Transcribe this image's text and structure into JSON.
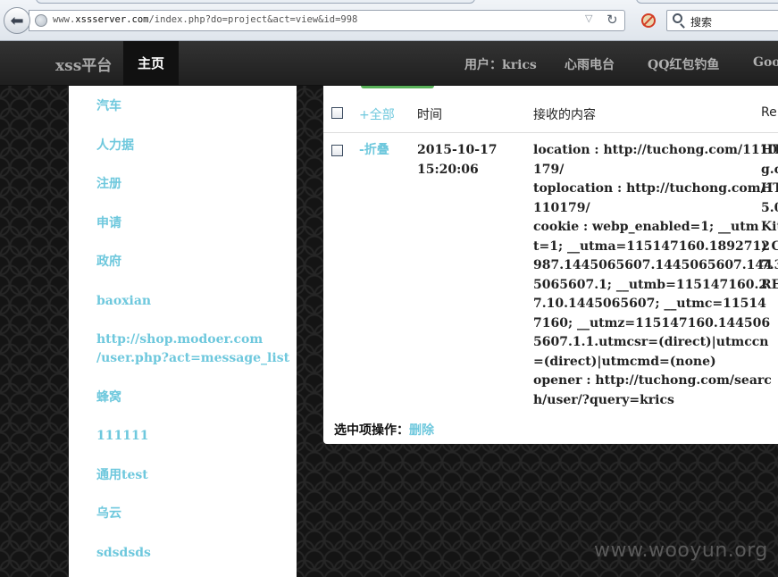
{
  "browser": {
    "url_prefix": "www.",
    "url_domain": "xssserver.com",
    "url_path": "/index.php?do=project&act=view&id=998",
    "search_placeholder": "搜索"
  },
  "navbar": {
    "brand": "xss平台",
    "home": "主页",
    "user": "用户：krics",
    "links": [
      "心雨电台",
      "QQ红包钓鱼",
      "Goo"
    ]
  },
  "sidebar": {
    "items": [
      "汽车",
      "人力据",
      "注册",
      "申请",
      "政府",
      "baoxian",
      "http://shop.modoer.com",
      "/user.php?act=message_list",
      "蜂窝",
      "111111",
      "通用test",
      "乌云",
      "sdsdsds"
    ]
  },
  "table": {
    "headers": {
      "expand_all": "+全部",
      "time": "时间",
      "content": "接收的内容",
      "extra": "Re"
    },
    "rows": [
      {
        "toggle": "-折叠",
        "date": "2015-10-17",
        "time": "15:20:06",
        "content_lines": [
          "location : http://tuchong.com/1110",
          "179/",
          "toplocation : http://tuchong.com/1",
          "110179/",
          "cookie : webp_enabled=1; __utm",
          "t=1; __utma=115147160.1892712",
          "987.1445065607.1445065607.144",
          "5065607.1; __utmb=115147160.2",
          "7.10.1445065607; __utmc=11514",
          "7160; __utmz=115147160.144506",
          "5607.1.1.utmcsr=(direct)|utmccn",
          "=(direct)|utmcmd=(none)",
          "opener : http://tuchong.com/searc",
          "h/user/?query=krics"
        ],
        "extra_lines": [
          "HT",
          "g.c",
          "HT",
          "5.0",
          "Kit",
          ") C",
          "7.3",
          "RE"
        ]
      }
    ],
    "footer": {
      "label": "选中项操作：",
      "delete": "删除"
    }
  },
  "watermark": "www.wooyun.org",
  "colors": {
    "link": "#6ec8dd",
    "navbar": "#2a2a2a",
    "accent_green": "#58b058"
  }
}
